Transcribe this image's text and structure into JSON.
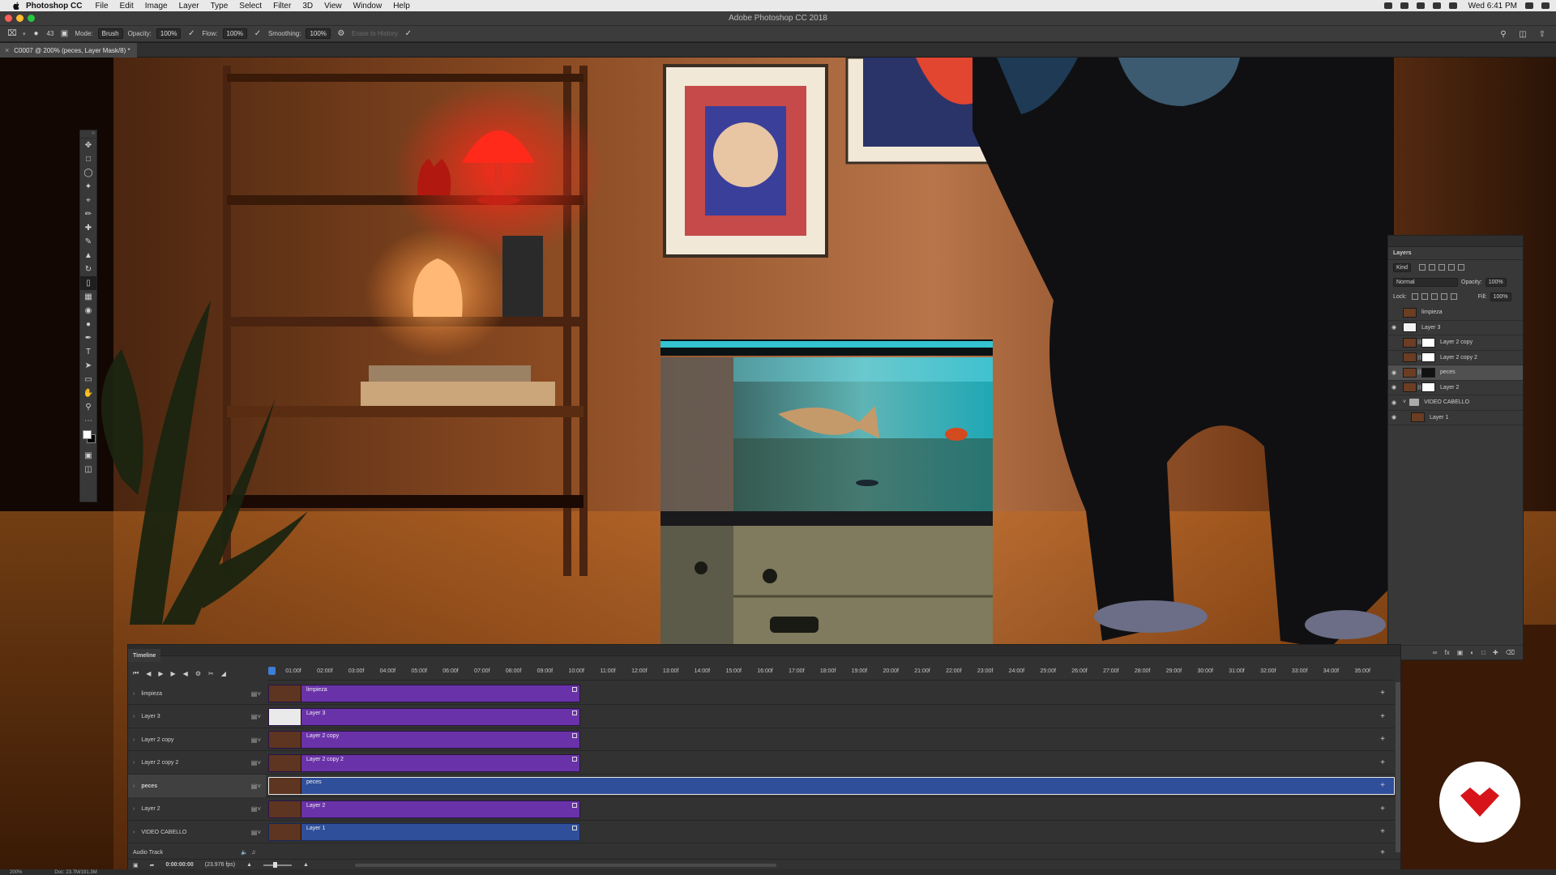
{
  "menubar": {
    "app_name": "Photoshop CC",
    "menus": [
      "File",
      "Edit",
      "Image",
      "Layer",
      "Type",
      "Select",
      "Filter",
      "3D",
      "View",
      "Window",
      "Help"
    ],
    "clock": "Wed 6:41 PM"
  },
  "window": {
    "title": "Adobe Photoshop CC 2018"
  },
  "options_bar": {
    "brush_size": "43",
    "mode_label": "Mode:",
    "mode_value": "Brush",
    "opacity_label": "Opacity:",
    "opacity_value": "100%",
    "flow_label": "Flow:",
    "flow_value": "100%",
    "smoothing_label": "Smoothing:",
    "smoothing_value": "100%",
    "erase_history": "Erase to History"
  },
  "document": {
    "tab_label": "C0007 @ 200% (peces, Layer Mask/8) *"
  },
  "layers_panel": {
    "title": "Layers",
    "kind_label": "Kind",
    "blend_mode": "Normal",
    "opacity_label": "Opacity:",
    "opacity_value": "100%",
    "lock_label": "Lock:",
    "fill_label": "Fill:",
    "fill_value": "100%",
    "layers": [
      {
        "name": "limpieza",
        "visible": false,
        "mask": "none",
        "thumb": "photo",
        "indent": false,
        "group": false,
        "selected": false
      },
      {
        "name": "Layer 3",
        "visible": true,
        "mask": "none",
        "thumb": "white",
        "indent": false,
        "group": false,
        "selected": false
      },
      {
        "name": "Layer 2 copy",
        "visible": false,
        "mask": "white",
        "thumb": "photo",
        "indent": false,
        "group": false,
        "selected": false
      },
      {
        "name": "Layer 2 copy 2",
        "visible": false,
        "mask": "white",
        "thumb": "photo",
        "indent": false,
        "group": false,
        "selected": false
      },
      {
        "name": "peces",
        "visible": true,
        "mask": "dark",
        "thumb": "photo",
        "indent": false,
        "group": false,
        "selected": true
      },
      {
        "name": "Layer 2",
        "visible": true,
        "mask": "white",
        "thumb": "photo",
        "indent": false,
        "group": false,
        "selected": false
      },
      {
        "name": "VIDEO CABELLO",
        "visible": true,
        "mask": "none",
        "thumb": "folder",
        "indent": false,
        "group": true,
        "selected": false
      },
      {
        "name": "Layer 1",
        "visible": true,
        "mask": "none",
        "thumb": "photo",
        "indent": true,
        "group": false,
        "selected": false
      }
    ]
  },
  "timeline": {
    "title": "Timeline",
    "ticks": [
      "01:00f",
      "02:00f",
      "03:00f",
      "04:00f",
      "05:00f",
      "06:00f",
      "07:00f",
      "08:00f",
      "09:00f",
      "10:00f",
      "11:00f",
      "12:00f",
      "13:00f",
      "14:00f",
      "15:00f",
      "16:00f",
      "17:00f",
      "18:00f",
      "19:00f",
      "20:00f",
      "21:00f",
      "22:00f",
      "23:00f",
      "24:00f",
      "25:00f",
      "26:00f",
      "27:00f",
      "28:00f",
      "29:00f",
      "30:00f",
      "31:00f",
      "32:00f",
      "33:00f",
      "34:00f",
      "35:00f"
    ],
    "tracks": [
      {
        "name": "limpieza",
        "clip": "limpieza",
        "color": "purple",
        "long": false,
        "thumb": "photo",
        "selected": false
      },
      {
        "name": "Layer 3",
        "clip": "Layer 3",
        "color": "purple",
        "long": false,
        "thumb": "white",
        "selected": false
      },
      {
        "name": "Layer 2 copy",
        "clip": "Layer 2 copy",
        "color": "purple",
        "long": false,
        "thumb": "photo",
        "selected": false
      },
      {
        "name": "Layer 2 copy 2",
        "clip": "Layer 2 copy 2",
        "color": "purple",
        "long": false,
        "thumb": "photo",
        "selected": false
      },
      {
        "name": "peces",
        "clip": "peces",
        "color": "blue",
        "long": true,
        "thumb": "photo",
        "selected": true
      },
      {
        "name": "Layer 2",
        "clip": "Layer 2",
        "color": "purple",
        "long": false,
        "thumb": "photo",
        "selected": false
      },
      {
        "name": "VIDEO CABELLO",
        "clip": "Layer 1",
        "color": "blue",
        "long": false,
        "thumb": "photo",
        "selected": false
      }
    ],
    "audio_track": "Audio Track",
    "timecode": "0:00:00:00",
    "fps": "(23.976 fps)"
  },
  "status_bar": {
    "zoom": "200%",
    "doc": "Doc: 23.7M/191.3M"
  }
}
